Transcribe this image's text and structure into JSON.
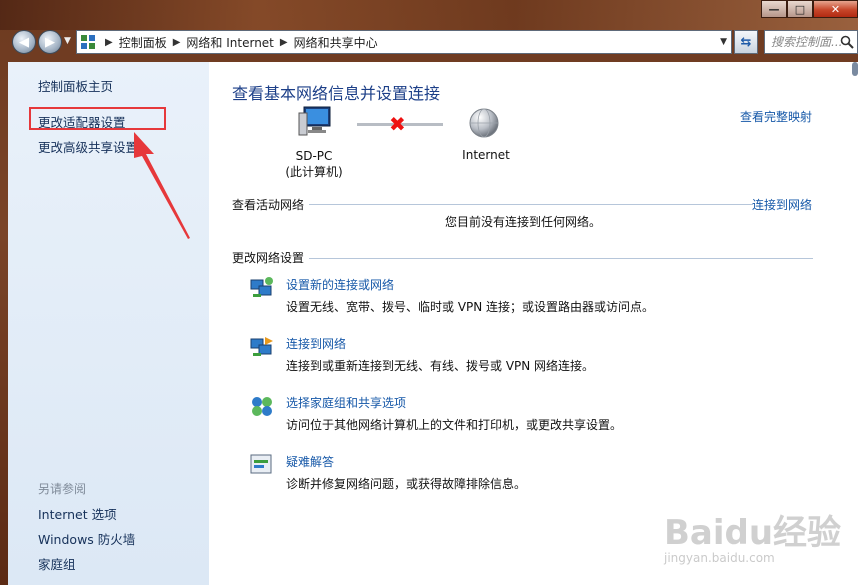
{
  "window": {
    "caption_buttons": [
      "—",
      "□",
      "✕"
    ]
  },
  "nav": {
    "breadcrumbs": [
      "控制面板",
      "网络和 Internet",
      "网络和共享中心"
    ],
    "search_placeholder": "搜索控制面..."
  },
  "sidebar": {
    "home": "控制面板主页",
    "items": [
      "更改适配器设置",
      "更改高级共享设置"
    ],
    "see_also_title": "另请参阅",
    "see_also": [
      "Internet 选项",
      "Windows 防火墙",
      "家庭组"
    ]
  },
  "main": {
    "title": "查看基本网络信息并设置连接",
    "full_map_link": "查看完整映射",
    "computer": {
      "name": "SD-PC",
      "sub": "(此计算机)"
    },
    "internet_label": "Internet",
    "active_networks": {
      "heading": "查看活动网络",
      "connect_link": "连接到网络",
      "status": "您目前没有连接到任何网络。"
    },
    "change_settings": {
      "heading": "更改网络设置",
      "tasks": [
        {
          "link": "设置新的连接或网络",
          "desc": "设置无线、宽带、拨号、临时或 VPN 连接；或设置路由器或访问点。"
        },
        {
          "link": "连接到网络",
          "desc": "连接到或重新连接到无线、有线、拨号或 VPN 网络连接。"
        },
        {
          "link": "选择家庭组和共享选项",
          "desc": "访问位于其他网络计算机上的文件和打印机，或更改共享设置。"
        },
        {
          "link": "疑难解答",
          "desc": "诊断并修复网络问题，或获得故障排除信息。"
        }
      ]
    }
  },
  "watermark": {
    "text": "Baidu经验",
    "sub": "jingyan.baidu.com"
  },
  "colors": {
    "accent_link": "#1658a8",
    "title": "#1c3f88",
    "annotation": "#e6383b",
    "sidebar_bg": "#e3edf8"
  },
  "icons": [
    "back-arrow-icon",
    "forward-arrow-icon",
    "control-panel-icon",
    "refresh-icon",
    "search-icon",
    "computer-icon",
    "globe-icon",
    "disconnected-x-icon",
    "new-connection-icon",
    "connect-network-icon",
    "homegroup-icon",
    "troubleshoot-icon"
  ]
}
